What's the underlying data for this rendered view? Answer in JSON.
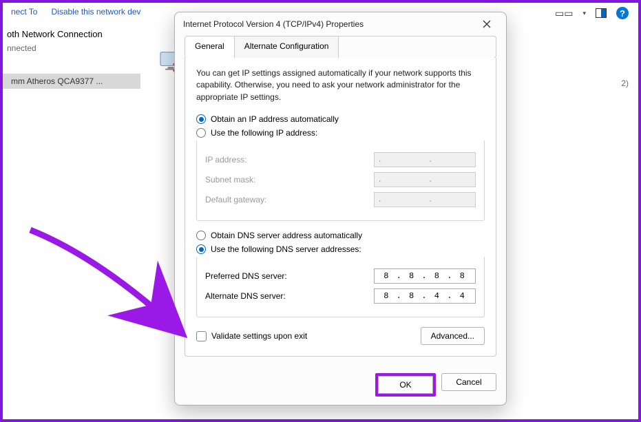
{
  "bg": {
    "toolbar": {
      "connect_to": "nect To",
      "disable": "Disable this network dev"
    },
    "adapter": {
      "name": "oth Network Connection",
      "status": "nnected",
      "desc": "mm Atheros QCA9377 ..."
    },
    "count_suffix": "2)"
  },
  "dialog": {
    "title": "Internet Protocol Version 4 (TCP/IPv4) Properties",
    "tabs": {
      "general": "General",
      "alternate": "Alternate Configuration"
    },
    "description": "You can get IP settings assigned automatically if your network supports this capability. Otherwise, you need to ask your network administrator for the appropriate IP settings.",
    "ip": {
      "auto_label": "Obtain an IP address automatically",
      "manual_label": "Use the following IP address:",
      "address_label": "IP address:",
      "mask_label": "Subnet mask:",
      "gateway_label": "Default gateway:",
      "placeholder_dots": ".       .       ."
    },
    "dns": {
      "auto_label": "Obtain DNS server address automatically",
      "manual_label": "Use the following DNS server addresses:",
      "preferred_label": "Preferred DNS server:",
      "alternate_label": "Alternate DNS server:",
      "preferred_value": "8 . 8 . 8 . 8",
      "alternate_value": "8 . 8 . 4 . 4"
    },
    "validate_label": "Validate settings upon exit",
    "advanced_label": "Advanced...",
    "ok_label": "OK",
    "cancel_label": "Cancel"
  }
}
